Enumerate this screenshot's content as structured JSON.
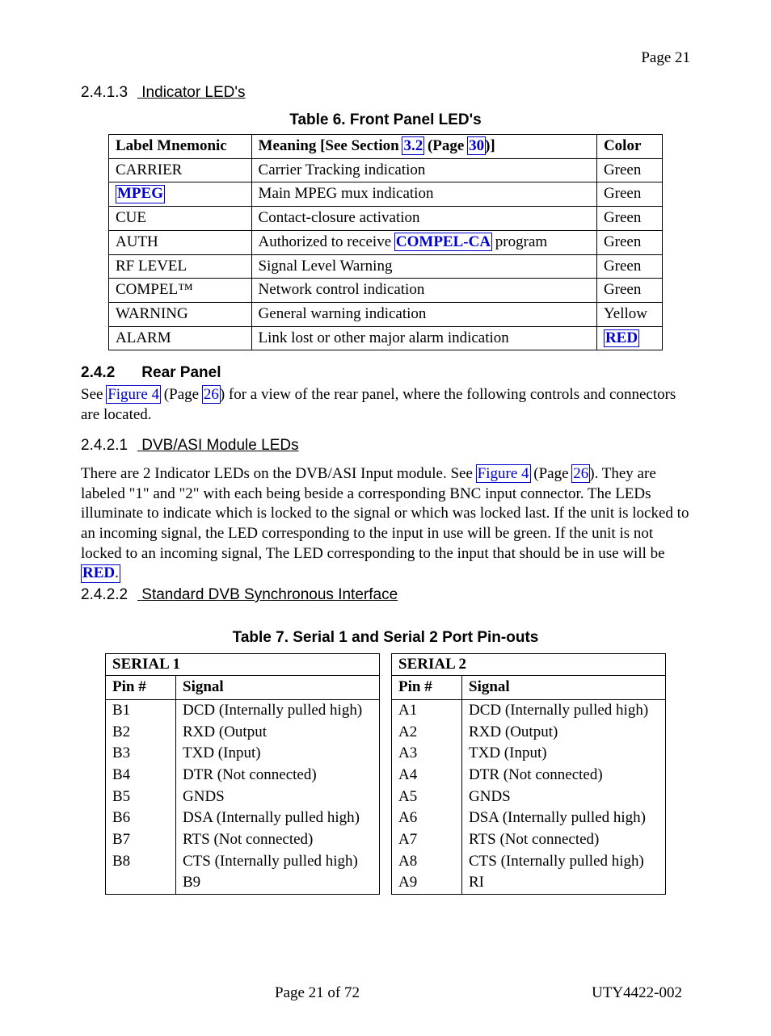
{
  "page_top": "Page 21",
  "sec2413": {
    "num": "2.4.1.3",
    "title": "Indicator LED's"
  },
  "t6_caption": "Table 6.  Front Panel LED's",
  "t6_head": {
    "c1": "Label Mnemonic",
    "c2a": "Meaning",
    "c2b": " [See Section ",
    "c2_link1": "3.2",
    "c2c": " (Page ",
    "c2_link2": "30",
    "c2d": ")]",
    "c3": "Color"
  },
  "t6_rows": [
    {
      "c1_link": "",
      "c1": "CARRIER",
      "c2": "Carrier Tracking indication",
      "c3": "Green"
    },
    {
      "c1_link": "MPEG",
      "c1": "",
      "c2": "Main MPEG mux indication",
      "c3": "Green"
    },
    {
      "c1": "CUE",
      "c2": "Contact-closure activation",
      "c3": "Green"
    },
    {
      "c1": "AUTH",
      "c2a": "Authorized to receive ",
      "c2_link": "COMPEL-CA",
      "c2b": " program",
      "c3": "Green"
    },
    {
      "c1": "RF LEVEL",
      "c2": "Signal Level Warning",
      "c3": "Green"
    },
    {
      "c1": "COMPEL™",
      "c2": "Network control indication",
      "c3": "Green"
    },
    {
      "c1": "WARNING",
      "c2": "General warning indication",
      "c3": "Yellow"
    },
    {
      "c1": "ALARM",
      "c2": "Link lost or other major alarm indication",
      "c3_link": "RED"
    }
  ],
  "sec242": {
    "num": "2.4.2",
    "title": "Rear Panel"
  },
  "p242a": "See ",
  "p242_link1": "Figure 4",
  "p242b": " (Page ",
  "p242_link2": "26",
  "p242c": ") for a view of the rear panel, where the following controls and connectors are located.",
  "sec2421": {
    "num": "2.4.2.1",
    "title": "DVB/ASI Module LEDs"
  },
  "p2421a": "There are 2 Indicator LEDs on the DVB/ASI Input module.  See ",
  "p2421_link1": "Figure 4",
  "p2421b": " (Page ",
  "p2421_link2": "26",
  "p2421c": ").  They are labeled \"1\" and \"2\" with each being beside a corresponding BNC input connector.  The LEDs illuminate to indicate which is locked to the signal or which was locked last.  If the unit is locked to an incoming signal, the LED corresponding to the input in use will be green.  If the unit is not locked to an incoming signal, The LED corresponding to the input that should be in use will be ",
  "p2421_link3": "RED",
  "p2421d": ".",
  "sec2422": {
    "num": "2.4.2.2",
    "title": "Standard DVB Synchronous Interface"
  },
  "t7_caption": "Table 7.  Serial 1 and Serial 2 Port Pin-outs",
  "t7_s1_title": "SERIAL 1",
  "t7_s2_title": "SERIAL 2",
  "t7_h1": "Pin #",
  "t7_h2": "Signal",
  "t7_s1": [
    {
      "p": "B1",
      "s": "DCD (Internally pulled high)"
    },
    {
      "p": "B2",
      "s": "RXD (Output"
    },
    {
      "p": "B3",
      "s": "TXD (Input)"
    },
    {
      "p": "B4",
      "s": "DTR (Not connected)"
    },
    {
      "p": "B5",
      "s": "GNDS"
    },
    {
      "p": "B6",
      "s": "DSA (Internally pulled high)"
    },
    {
      "p": "B7",
      "s": "RTS (Not connected)"
    },
    {
      "p": "B8",
      "s": "CTS (Internally pulled high)"
    },
    {
      "p": "",
      "s": "B9"
    }
  ],
  "t7_s2": [
    {
      "p": "A1",
      "s": "DCD (Internally pulled high)"
    },
    {
      "p": "A2",
      "s": "RXD (Output)"
    },
    {
      "p": "A3",
      "s": "TXD (Input)"
    },
    {
      "p": "A4",
      "s": "DTR (Not connected)"
    },
    {
      "p": "A5",
      "s": "GNDS"
    },
    {
      "p": "A6",
      "s": "DSA (Internally pulled high)"
    },
    {
      "p": "A7",
      "s": "RTS (Not connected)"
    },
    {
      "p": "A8",
      "s": "CTS (Internally pulled high)"
    },
    {
      "p": "A9",
      "s": "RI"
    }
  ],
  "footer_left": "Page 21 of 72",
  "footer_right": "UTY4422-002"
}
